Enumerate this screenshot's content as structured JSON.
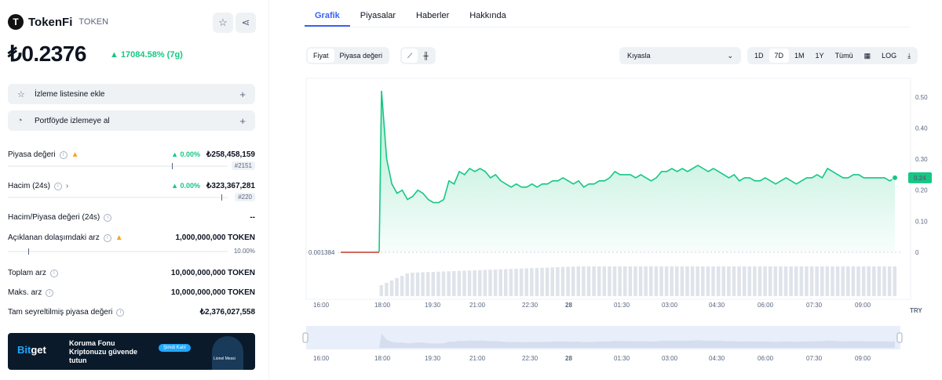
{
  "coin": {
    "logo_letter": "T",
    "name": "TokenFi",
    "symbol": "TOKEN",
    "price": "₺0.2376",
    "change": "▲ 17084.58% (7g)"
  },
  "actions": {
    "watchlist": "İzleme listesine ekle",
    "portfolio": "Portföyde izlemeye al",
    "plus": "+"
  },
  "stats": {
    "market_cap": {
      "label": "Piyasa değeri",
      "change": "▲ 0.00%",
      "value": "₺258,458,159",
      "rank": "#2151"
    },
    "volume": {
      "label": "Hacim (24s)",
      "change": "▲ 0.00%",
      "value": "₺323,367,281",
      "rank": "#220"
    },
    "vol_mcap": {
      "label": "Hacim/Piyasa değeri (24s)",
      "value": "--"
    },
    "circ_supply": {
      "label": "Açıklanan dolaşımdaki arz",
      "value": "1,000,000,000 TOKEN",
      "percent": "10.00%"
    },
    "total_supply": {
      "label": "Toplam arz",
      "value": "10,000,000,000 TOKEN"
    },
    "max_supply": {
      "label": "Maks. arz",
      "value": "10,000,000,000 TOKEN"
    },
    "fdv": {
      "label": "Tam seyreltilmiş piyasa değeri",
      "value": "₺2,376,027,558"
    }
  },
  "banner": {
    "brand_a": "Bit",
    "brand_b": "get",
    "line1": "Koruma Fonu",
    "line2": "Kriptonuzu güvende",
    "line3": "tutun",
    "cta": "Şimdi Katıl",
    "person": "Lionel Messi"
  },
  "tabs": [
    "Grafik",
    "Piyasalar",
    "Haberler",
    "Hakkında"
  ],
  "toolbar": {
    "type_options": [
      "Fiyat",
      "Piyasa değeri"
    ],
    "compare": "Kıyasla",
    "ranges": [
      "1D",
      "7D",
      "1M",
      "1Y",
      "Tümü"
    ],
    "log": "LOG",
    "chev": "⌄"
  },
  "icons": {
    "star": "star-icon",
    "share": "share-icon",
    "line": "line-chart-icon",
    "candle": "candlestick-icon",
    "calendar": "calendar-icon",
    "download": "download-icon"
  },
  "colors": {
    "up": "#16c784",
    "accent": "#3861fb",
    "baseline": "#c0392b"
  },
  "chart_data": {
    "type": "line",
    "currency": "TRY",
    "start_label": "0.001384",
    "last_value_label": "0.24",
    "y_ticks": [
      "0.50",
      "0.40",
      "0.30",
      "0.20",
      "0.10",
      "0"
    ],
    "x_ticks": [
      "16:00",
      "18:00",
      "19:30",
      "21:00",
      "22:30",
      "28",
      "01:30",
      "03:00",
      "04:30",
      "06:00",
      "07:30",
      "09:00"
    ],
    "ylim": [
      0,
      0.55
    ],
    "series": [
      {
        "values": [
          0.001384,
          0.001384,
          0.001384,
          0.001384,
          0.001384,
          0.001384,
          0.001384,
          0.001384,
          0.52,
          0.3,
          0.22,
          0.19,
          0.2,
          0.17,
          0.18,
          0.2,
          0.19,
          0.17,
          0.16,
          0.16,
          0.17,
          0.23,
          0.22,
          0.26,
          0.25,
          0.27,
          0.26,
          0.27,
          0.26,
          0.24,
          0.25,
          0.23,
          0.22,
          0.21,
          0.22,
          0.21,
          0.21,
          0.22,
          0.21,
          0.22,
          0.22,
          0.23,
          0.23,
          0.24,
          0.23,
          0.22,
          0.23,
          0.21,
          0.22,
          0.22,
          0.23,
          0.23,
          0.24,
          0.26,
          0.25,
          0.25,
          0.25,
          0.24,
          0.25,
          0.24,
          0.23,
          0.24,
          0.26,
          0.26,
          0.27,
          0.26,
          0.27,
          0.26,
          0.27,
          0.28,
          0.27,
          0.26,
          0.27,
          0.26,
          0.25,
          0.24,
          0.25,
          0.23,
          0.24,
          0.24,
          0.23,
          0.23,
          0.24,
          0.23,
          0.22,
          0.23,
          0.24,
          0.23,
          0.22,
          0.23,
          0.24,
          0.24,
          0.25,
          0.24,
          0.27,
          0.26,
          0.25,
          0.24,
          0.24,
          0.25,
          0.25,
          0.24,
          0.24,
          0.24,
          0.24,
          0.24,
          0.23,
          0.24
        ]
      }
    ]
  }
}
